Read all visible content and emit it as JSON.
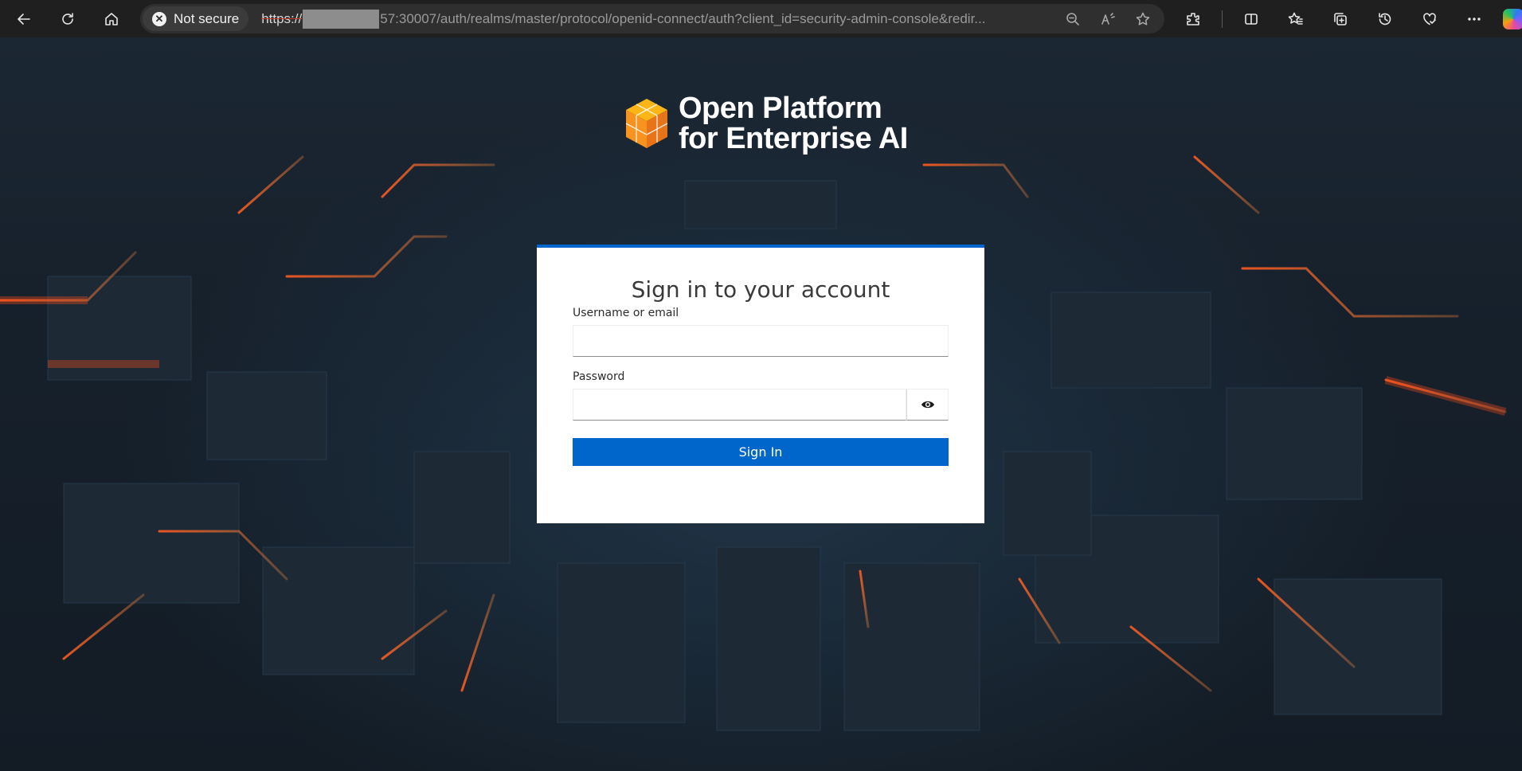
{
  "browser": {
    "security_label": "Not secure",
    "url_scheme": "https://",
    "url_rest": "57:30007/auth/realms/master/protocol/openid-connect/auth?client_id=security-admin-console&redir...",
    "toolbar_icons": [
      "back-icon",
      "refresh-icon",
      "home-icon"
    ],
    "address_icons": [
      "zoom-icon",
      "read-aloud-icon",
      "favorite-icon"
    ],
    "right_icons": [
      "extensions-icon",
      "split-screen-icon",
      "favorites-icon",
      "collections-icon",
      "history-icon",
      "performance-icon",
      "more-icon",
      "copilot-icon"
    ]
  },
  "logo": {
    "line1": "Open Platform",
    "line2": "for Enterprise AI"
  },
  "login": {
    "title": "Sign in to your account",
    "username_label": "Username or email",
    "username_value": "",
    "password_label": "Password",
    "password_value": "",
    "submit_label": "Sign In"
  },
  "colors": {
    "accent": "#0066cc",
    "logo_orange": "#f7931e",
    "logo_yellow": "#fbb517"
  }
}
